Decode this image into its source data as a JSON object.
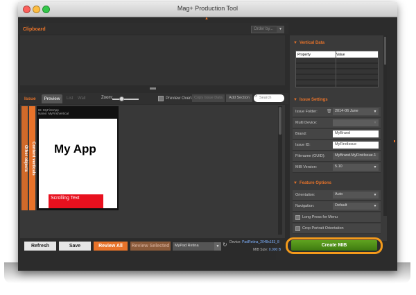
{
  "window": {
    "title": "Mag+ Production Tool"
  },
  "clipboard": {
    "title": "Clipboard",
    "order_by": "Order by..."
  },
  "tabs": {
    "issue": "Issue",
    "preview": "Preview",
    "list": "List",
    "wall": "Wall"
  },
  "toolbar": {
    "zoom_label": "Zoom:",
    "preview_overlays": "Preview Overlays",
    "copy_issue_data": "Copy Issue Data",
    "add_section": "Add Section",
    "search_placeholder": "Search"
  },
  "preview": {
    "meta_id": "ID: MyFirstApp",
    "meta_name": "Name: MyFirstVertical",
    "vtab_content": "Content verticals",
    "vtab_other": "Other objects",
    "app_title": "My App",
    "scroll_text": "Scrolling Text"
  },
  "bottom": {
    "refresh": "Refresh",
    "save": "Save",
    "review_all": "Review All",
    "review_selected": "Review Selected",
    "device_select": "MyPad Retina",
    "device_label": "Device:",
    "device_value": "PadRetina_2048x153_8",
    "mib_label": "MIB Size:",
    "mib_value": "0.000 B"
  },
  "vertical_data": {
    "title": "Vertical Data",
    "col_property": "Property",
    "col_value": "Value"
  },
  "issue_settings": {
    "title": "Issue Settings",
    "issue_folder_label": "Issue Folder:",
    "issue_folder_value": "2014-06 June",
    "multi_device_label": "Multi Device:",
    "brand_label": "Brand:",
    "brand_value": "MyBrand",
    "issue_id_label": "Issue ID:",
    "issue_id_value": "MyFirstIssue",
    "filename_label": "Filename (GUID):",
    "filename_value": "MyBrand.MyFirstIssue.1",
    "mib_version_label": "MIB Version:",
    "mib_version_value": "5.10"
  },
  "feature_options": {
    "title": "Feature Options",
    "orientation_label": "Orientation:",
    "orientation_value": "Auto",
    "navigation_label": "Navigation:",
    "navigation_value": "Default",
    "long_press": "Long Press for Menu",
    "crop_portrait": "Crop Portrait Orientation"
  },
  "create_mib": "Create MIB",
  "colors": {
    "accent": "#e8732a",
    "create": "#4f8f18",
    "highlight_ring": "#f39a1b"
  }
}
